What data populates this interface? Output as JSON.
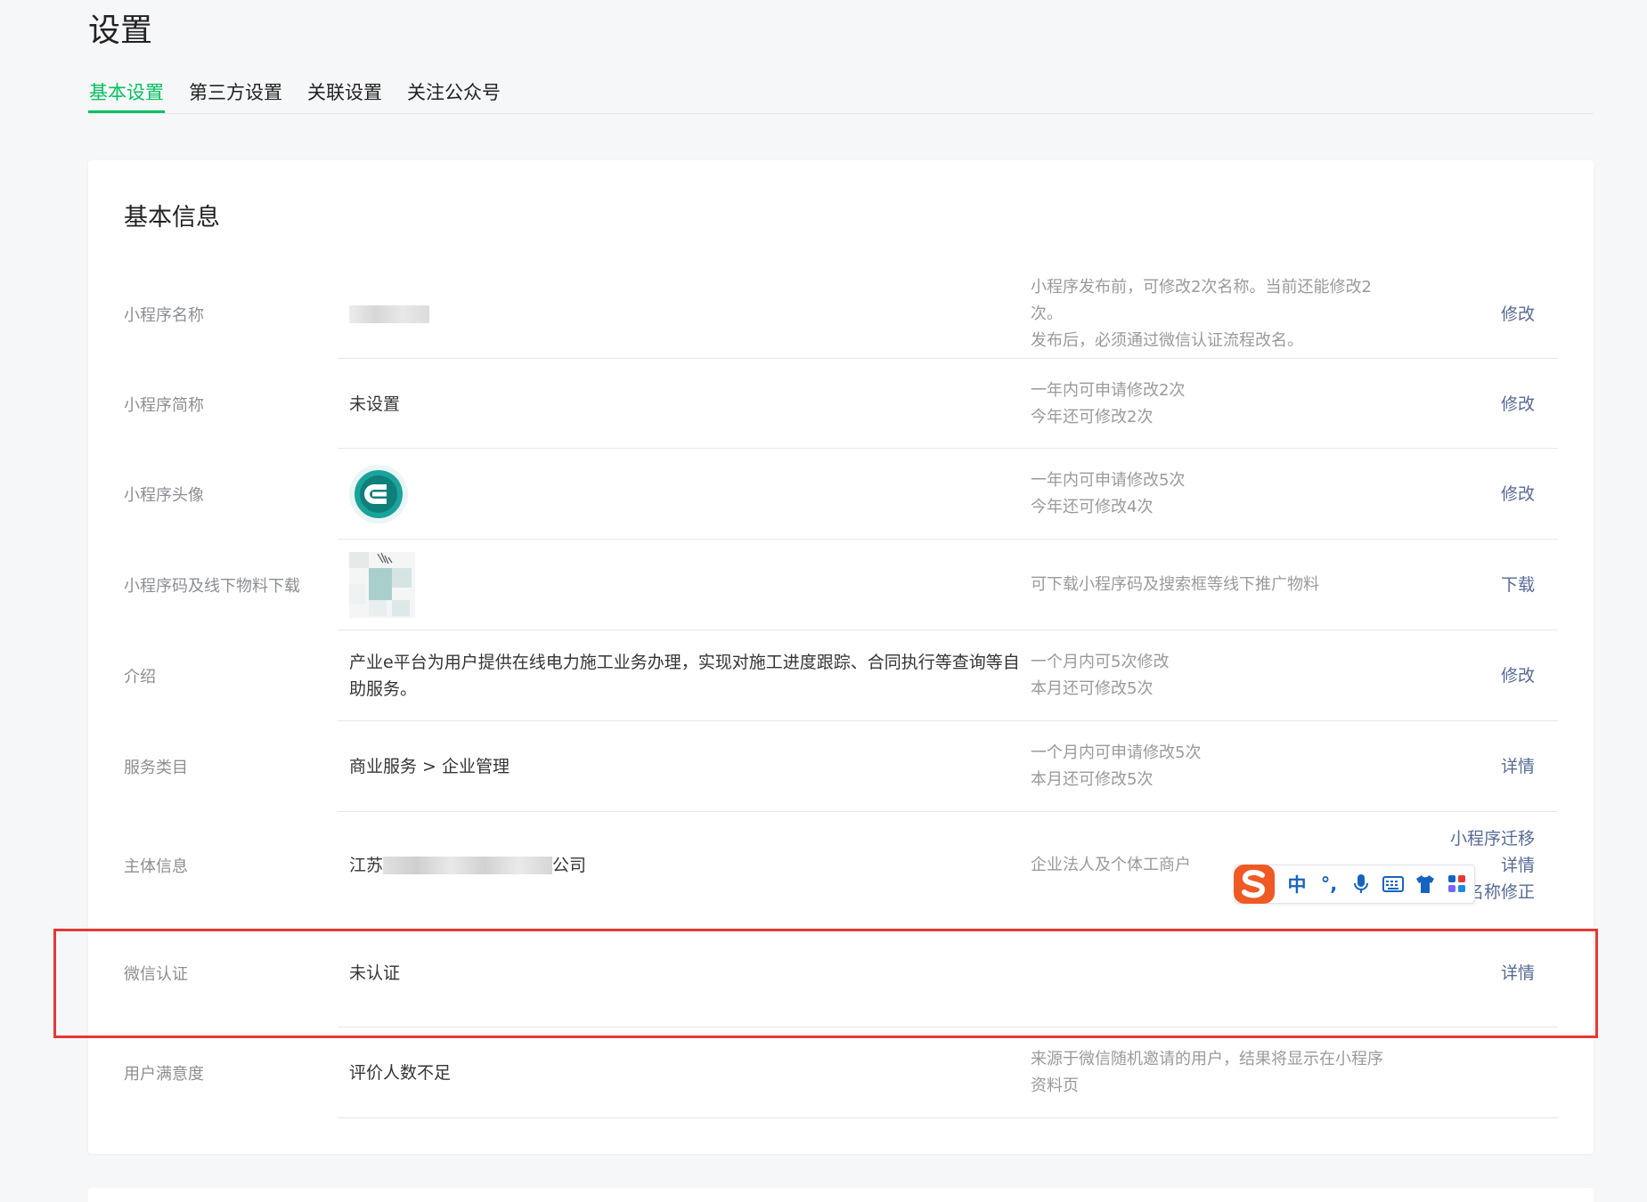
{
  "page": {
    "title": "设置"
  },
  "tabs": [
    {
      "label": "基本设置",
      "active": true
    },
    {
      "label": "第三方设置",
      "active": false
    },
    {
      "label": "关联设置",
      "active": false
    },
    {
      "label": "关注公众号",
      "active": false
    }
  ],
  "section": {
    "title": "基本信息",
    "rows": [
      {
        "label": "小程序名称",
        "value": "",
        "tips": [
          "小程序发布前，可修改2次名称。当前还能修改2",
          "次。",
          "发布后，必须通过微信认证流程改名。"
        ],
        "actions": [
          "修改"
        ]
      },
      {
        "label": "小程序简称",
        "value": "未设置",
        "tips": [
          "一年内可申请修改2次",
          "今年还可修改2次"
        ],
        "actions": [
          "修改"
        ]
      },
      {
        "label": "小程序头像",
        "value": "",
        "tips": [
          "一年内可申请修改5次",
          "今年还可修改4次"
        ],
        "actions": [
          "修改"
        ]
      },
      {
        "label": "小程序码及线下物料下载",
        "value": "",
        "tips": [
          "可下载小程序码及搜索框等线下推广物料"
        ],
        "actions": [
          "下载"
        ]
      },
      {
        "label": "介绍",
        "value_lines": [
          "产业e平台为用户提供在线电力施工业务办理，实现对施工进度跟踪、合同执行等查询等自",
          "助服务。"
        ],
        "tips": [
          "一个月内可5次修改",
          "本月还可修改5次"
        ],
        "actions": [
          "修改"
        ]
      },
      {
        "label": "服务类目",
        "value": "商业服务 > 企业管理",
        "tips": [
          "一个月内可申请修改5次",
          "本月还可修改5次"
        ],
        "actions": [
          "详情"
        ]
      },
      {
        "label": "主体信息",
        "value_prefix": "江苏",
        "value_suffix": "公司",
        "tips": [
          "企业法人及个体工商户"
        ],
        "actions": [
          "小程序迁移",
          "详情",
          "名称修正"
        ]
      },
      {
        "label": "微信认证",
        "value": "未认证",
        "tips": [],
        "actions": [
          "详情"
        ]
      },
      {
        "label": "用户满意度",
        "value": "评价人数不足",
        "tips": [
          "来源于微信随机邀请的用户，结果将显示在小程序",
          "资料页"
        ],
        "actions": []
      }
    ]
  },
  "ime_toolbar": {
    "mode": "中",
    "punct": "°,",
    "icons": [
      "microphone-icon",
      "keyboard-icon",
      "shirt-icon",
      "apps-icon"
    ]
  },
  "colors": {
    "accent": "#07c160",
    "link": "#576b95",
    "highlight": "#e53935"
  }
}
